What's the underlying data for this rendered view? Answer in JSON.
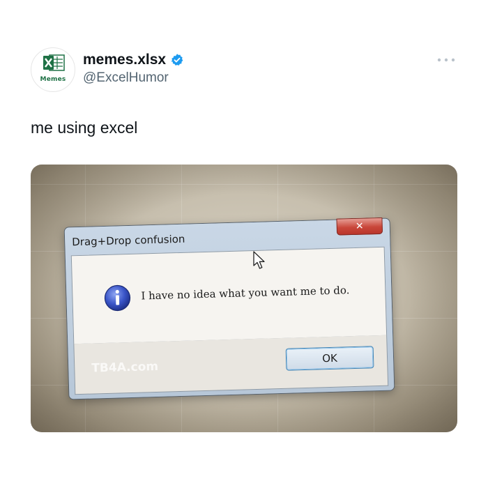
{
  "tweet": {
    "account_name": "memes.xlsx",
    "handle": "@ExcelHumor",
    "avatar_caption": "Memes",
    "text": "me using excel"
  },
  "dialog": {
    "title": "Drag+Drop confusion",
    "close_glyph": "✕",
    "message": "I have no idea what you want me to do.",
    "ok_label": "OK",
    "watermark": "TB4A.com"
  },
  "icons": {
    "verified": "verified-badge-icon",
    "more": "more-options-icon",
    "info": "information-icon",
    "cursor": "mouse-pointer-icon",
    "excel": "excel-logo-icon"
  },
  "colors": {
    "verified_blue": "#1d9bf0",
    "excel_green": "#1e7145",
    "handle_gray": "#536471"
  }
}
